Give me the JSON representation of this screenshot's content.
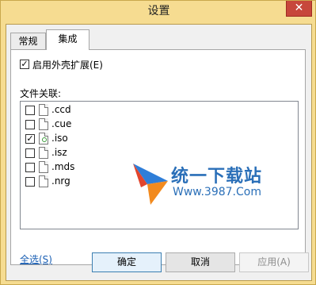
{
  "window": {
    "title": "设置",
    "close_glyph": "✕"
  },
  "tabs": [
    {
      "label": "常规",
      "active": false
    },
    {
      "label": "集成",
      "active": true
    }
  ],
  "shell_extension": {
    "label": "启用外壳扩展(E)",
    "checked": true,
    "check_glyph": "✓"
  },
  "file_assoc": {
    "label": "文件关联:",
    "items": [
      {
        "ext": ".ccd",
        "checked": false,
        "mark": ""
      },
      {
        "ext": ".cue",
        "checked": false,
        "mark": ""
      },
      {
        "ext": ".iso",
        "checked": true,
        "mark": "✓"
      },
      {
        "ext": ".isz",
        "checked": false,
        "mark": ""
      },
      {
        "ext": ".mds",
        "checked": false,
        "mark": ""
      },
      {
        "ext": ".nrg",
        "checked": false,
        "mark": ""
      }
    ]
  },
  "watermark": {
    "name": "统一下载站",
    "url": "Www.3987.Com"
  },
  "select_all": "全选(S)",
  "buttons": {
    "ok": "确定",
    "cancel": "取消",
    "apply": "应用(A)"
  },
  "colors": {
    "frame": "#f6dc91",
    "link": "#1a5fb4",
    "close": "#c7473b"
  }
}
